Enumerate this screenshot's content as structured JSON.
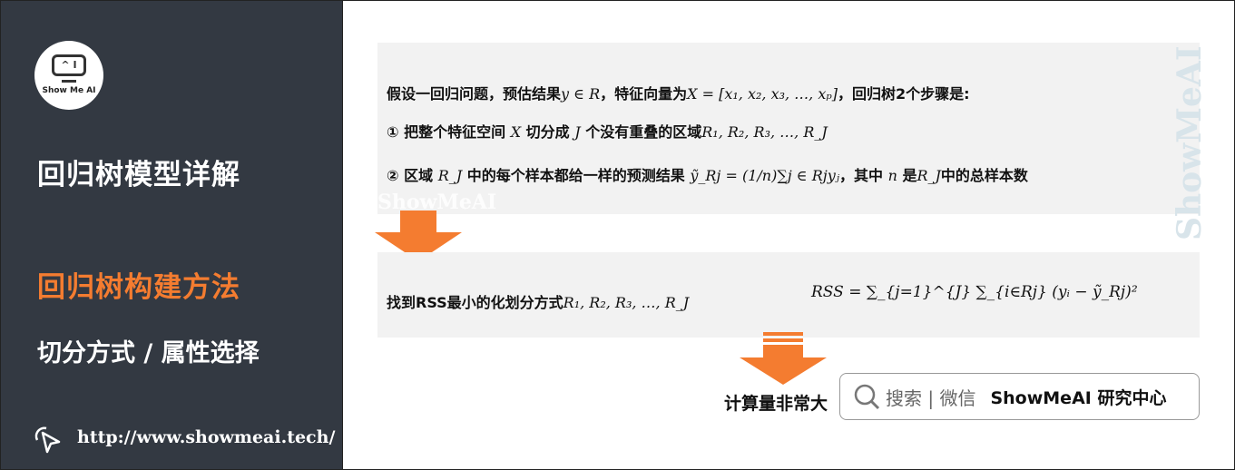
{
  "sidebar": {
    "logo_text": "Show Me AI",
    "logo_screen": "^ I",
    "title": "回归树模型详解",
    "section": "回归树构建方法",
    "subsection": "切分方式 / 属性选择",
    "url": "http://www.showmeai.tech/"
  },
  "main": {
    "line1_a": "假设一回归问题，预估结果",
    "line1_m1": "y ∈ R",
    "line1_b": "，特征向量为",
    "line1_m2": "X = [x₁, x₂, x₃, …, xₚ]",
    "line1_c": "，回归树2个步骤是:",
    "line2_a": "① 把整个特征空间 ",
    "line2_m1": "X",
    "line2_b": " 切分成 ",
    "line2_m2": "J",
    "line2_c": " 个没有重叠的区域",
    "line2_m3": "R₁, R₂, R₃, …, R_J",
    "line3_a": "② 区域 ",
    "line3_m1": "R_J",
    "line3_b": " 中的每个样本都给一样的预测结果 ",
    "line3_m2": "ỹ_Rj = (1/n)∑j ∈ Rjyⱼ",
    "line3_c": "，其中 ",
    "line3_m3": "n",
    "line3_d": " 是",
    "line3_m4": "R_J",
    "line3_e": "中的总样本数",
    "step2_a": "找到RSS最小的化划分方式",
    "step2_m": "R₁, R₂, R₃, …, R_J",
    "formula": "RSS = ∑_{j=1}^{J} ∑_{i∈Rj} (yᵢ − ỹ_Rj)²",
    "result": "计算量非常大",
    "watermark": "ShowMeAI",
    "vertical_watermark": "ShowMeAI"
  },
  "search_box": {
    "icon": "search-icon",
    "label": "搜索 | 微信",
    "brand": "ShowMeAI 研究中心"
  },
  "colors": {
    "sidebar_bg": "#333942",
    "accent": "#f47c30",
    "box_bg": "#f2f2f2"
  }
}
